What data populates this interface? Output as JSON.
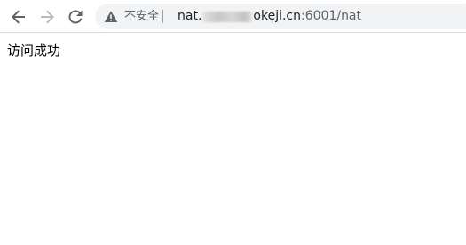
{
  "browser": {
    "security_label": "不安全",
    "url_domain_start": "nat.",
    "url_domain_end": "okeji.cn",
    "url_port_path": ":6001/nat"
  },
  "page": {
    "message": "访问成功"
  },
  "colors": {
    "toolbar_bg": "#ffffff",
    "omnibox_bg": "#f1f3f4",
    "icon_gray": "#5f6368",
    "icon_disabled": "#b8babd",
    "text": "#202124"
  },
  "icons": {
    "back": "arrow-left-icon",
    "forward": "arrow-right-icon",
    "reload": "reload-icon",
    "security": "warning-triangle-icon"
  }
}
